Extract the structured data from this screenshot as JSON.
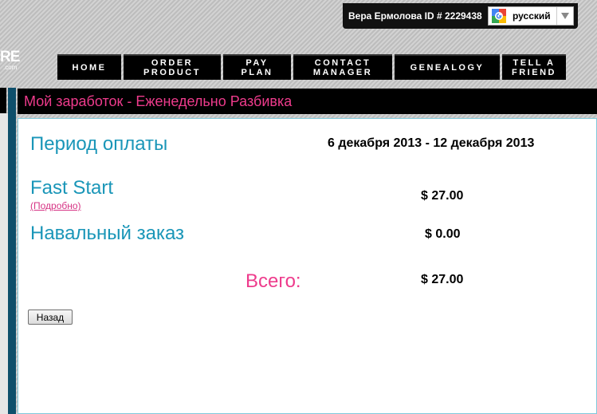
{
  "user_bar": {
    "user_label": "Вера Ермолова ID # 2229438",
    "language": "русский",
    "translate_icon": "google-translate-icon",
    "dropdown_icon": "triangle-down-icon"
  },
  "logo": {
    "text": "RE",
    "subtext": ".com"
  },
  "nav": {
    "items": [
      {
        "line1": "HOME",
        "line2": ""
      },
      {
        "line1": "ORDER",
        "line2": "PRODUCT"
      },
      {
        "line1": "PAY",
        "line2": "PLAN"
      },
      {
        "line1": "CONTACT",
        "line2": "MANAGER"
      },
      {
        "line1": "GENEALOGY",
        "line2": ""
      },
      {
        "line1": "TELL A",
        "line2": "FRIEND"
      }
    ]
  },
  "page": {
    "title": "Мой заработок - Еженедельно Разбивка",
    "period_label": "Период оплаты",
    "period_dates": "6 декабря 2013 - 12 декабря 2013",
    "fast_start_label": "Fast Start",
    "details_link": "(Подробно)",
    "fast_start_value": "$ 27.00",
    "bulk_order_label": "Навальный заказ",
    "bulk_order_value": "$ 0.00",
    "total_label": "Всего:",
    "total_value": "$ 27.00",
    "back_button": "Назад"
  },
  "colors": {
    "accent_pink": "#ee3b8c",
    "label_blue": "#1a96b8",
    "nav_background": "#000000"
  }
}
